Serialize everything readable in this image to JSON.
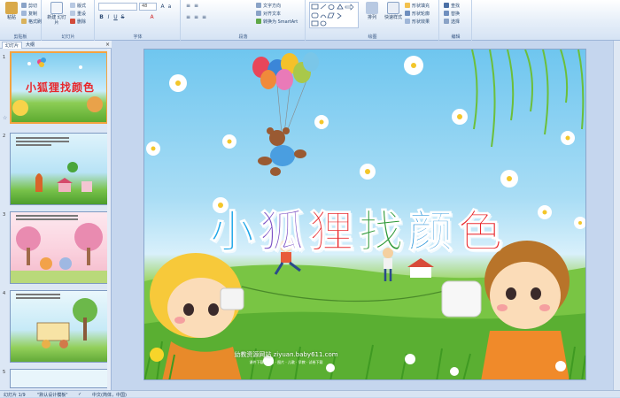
{
  "ribbon": {
    "clipboard": {
      "label": "剪贴板",
      "paste": "粘贴",
      "cut": "剪切",
      "copy": "复制",
      "format_painter": "格式刷"
    },
    "slides": {
      "label": "幻灯片",
      "new_slide": "新建\n幻灯片",
      "layout": "版式",
      "reset": "重设",
      "delete": "删除"
    },
    "font": {
      "label": "字体",
      "font_name": "",
      "font_size": "48"
    },
    "paragraph": {
      "label": "段落",
      "text_direction": "文字方向",
      "align_text": "对齐文本",
      "smartart": "转换为 SmartArt"
    },
    "drawing": {
      "label": "绘图",
      "arrange": "排列",
      "quick_styles": "快速样式",
      "shape_fill": "形状填充",
      "shape_outline": "形状轮廓",
      "shape_effects": "形状效果"
    },
    "editing": {
      "label": "编辑",
      "find": "查找",
      "replace": "替换",
      "select": "选择"
    }
  },
  "panel": {
    "tab_slides": "幻灯片",
    "tab_outline": "大纲",
    "close": "×",
    "thumbnails": [
      {
        "number": "1",
        "title": "小狐狸找颜色"
      },
      {
        "number": "2"
      },
      {
        "number": "3"
      },
      {
        "number": "4"
      },
      {
        "number": "5"
      }
    ]
  },
  "slide": {
    "title_chars": [
      {
        "char": "小",
        "color": "#1ea6e8"
      },
      {
        "char": "狐",
        "color": "#7a4fc4"
      },
      {
        "char": "狸",
        "color": "#e8262a"
      },
      {
        "char": "找",
        "color": "#2f9a3a"
      },
      {
        "char": "颜",
        "color": "#1e8fd8"
      },
      {
        "char": "色",
        "color": "#e8262a"
      }
    ],
    "credit": "幼教资源网站  ziyuan.baby611.com",
    "credit_small": "课件下载 · 动画 · 图片 · 儿歌 · 早教 · 试卷下载"
  },
  "status": {
    "slide_info": "幻灯片 1/9",
    "theme": "\"默认设计模板\"",
    "language": "中文(简体，中国)"
  },
  "colors": {
    "ribbon_bg": "#e4edf8",
    "panel_bg": "#dce7f5",
    "editor_bg": "#c5d6ee",
    "active_thumb": "#f4a340"
  }
}
